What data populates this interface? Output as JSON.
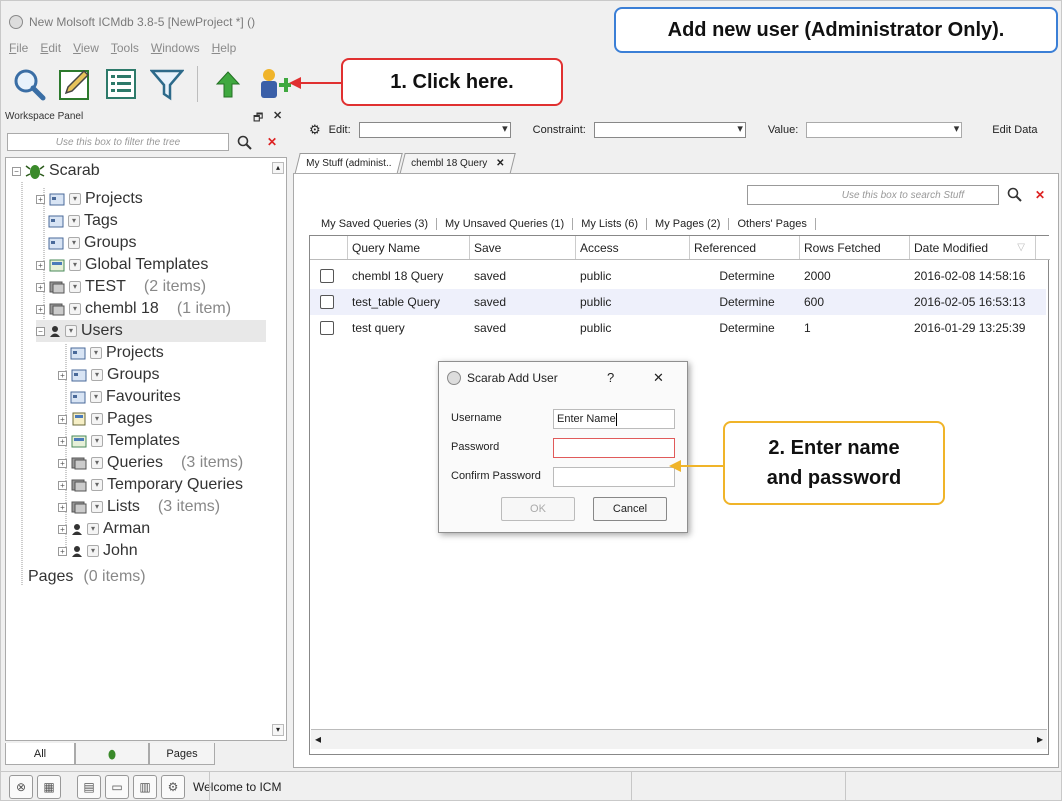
{
  "title_bar": {
    "app_title": "New Molsoft ICMdb 3.8-5  [NewProject *] ()"
  },
  "menu": [
    "File",
    "Edit",
    "View",
    "Tools",
    "Windows",
    "Help"
  ],
  "toolbar": {
    "buttons": [
      {
        "icon": "magnifier-icon"
      },
      {
        "icon": "pencil-icon"
      },
      {
        "icon": "list-icon"
      },
      {
        "icon": "filter-icon"
      },
      {
        "icon": "upload-arrow-icon"
      },
      {
        "icon": "add-user-icon"
      }
    ]
  },
  "callouts": {
    "header": "Add new user (Administrator Only).",
    "step1": "1. Click here.",
    "step2_line1": "2. Enter name",
    "step2_line2": "and password"
  },
  "workspace": {
    "title": "Workspace Panel",
    "filter_placeholder": "Use this box to filter the tree",
    "tree": [
      {
        "label": "Scarab",
        "count": ""
      },
      {
        "label": "Projects",
        "count": ""
      },
      {
        "label": "Tags",
        "count": ""
      },
      {
        "label": "Groups",
        "count": ""
      },
      {
        "label": "Global Templates",
        "count": ""
      },
      {
        "label": "TEST",
        "count": "(2 items)"
      },
      {
        "label": "chembl 18",
        "count": "(1 item)"
      },
      {
        "label": "Users",
        "count": ""
      },
      {
        "label": "Projects",
        "count": ""
      },
      {
        "label": "Groups",
        "count": ""
      },
      {
        "label": "Favourites",
        "count": ""
      },
      {
        "label": "Pages",
        "count": ""
      },
      {
        "label": "Templates",
        "count": ""
      },
      {
        "label": "Queries",
        "count": "(3 items)"
      },
      {
        "label": "Temporary Queries",
        "count": ""
      },
      {
        "label": "Lists",
        "count": "(3 items)"
      },
      {
        "label": "Arman",
        "count": ""
      },
      {
        "label": "John",
        "count": ""
      },
      {
        "label": "Pages",
        "count": "(0 items)"
      }
    ],
    "bottom_tabs": [
      "All",
      "",
      "Pages"
    ]
  },
  "edit_bar": {
    "edit_label": "Edit:",
    "constraint_label": "Constraint:",
    "value_label": "Value:",
    "edit_data": "Edit Data"
  },
  "doc_tabs": [
    "My Stuff (administ..",
    "chembl 18 Query"
  ],
  "stuff": {
    "search_placeholder": "Use this box to search Stuff",
    "tabs": [
      "My Saved Queries (3)",
      "My Unsaved Queries (1)",
      "My Lists (6)",
      "My Pages (2)",
      "Others' Pages"
    ],
    "columns": [
      "Query Name",
      "Save",
      "Access",
      "Referenced",
      "Rows Fetched",
      "Date Modified"
    ],
    "rows": [
      [
        "chembl 18 Query",
        "saved",
        "public",
        "Determine",
        "2000",
        "2016-02-08 14:58:16"
      ],
      [
        "test_table Query",
        "saved",
        "public",
        "Determine",
        "600",
        "2016-02-05 16:53:13"
      ],
      [
        "test query",
        "saved",
        "public",
        "Determine",
        "1",
        "2016-01-29 13:25:39"
      ]
    ]
  },
  "dialog": {
    "title": "Scarab Add User",
    "help": "?",
    "close": "✕",
    "username_label": "Username",
    "password_label": "Password",
    "confirm_label": "Confirm Password",
    "username_value": "Enter Name",
    "ok": "OK",
    "cancel": "Cancel"
  },
  "status_bar": {
    "message": "Welcome to ICM"
  },
  "colors": {
    "callout_blue": "#3b7fd6",
    "callout_red": "#e03030",
    "callout_orange": "#f0b429",
    "row_highlight": "#eef0fb"
  }
}
